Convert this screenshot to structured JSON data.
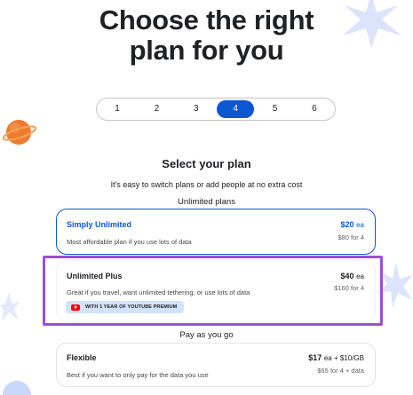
{
  "header": {
    "title": "Choose the right\nplan for you"
  },
  "stepper": {
    "options": [
      "1",
      "2",
      "3",
      "4",
      "5",
      "6"
    ],
    "selected": "4"
  },
  "main": {
    "section_title": "Select your plan",
    "section_subtitle": "It's easy to switch plans or add people at no extra cost",
    "group_unlimited": "Unlimited plans",
    "group_payg": "Pay as you go"
  },
  "plans": [
    {
      "name": "Simply Unlimited",
      "price": "$20",
      "price_unit": "ea",
      "description": "Most affordable plan if you use lots of data",
      "total": "$80 for 4"
    },
    {
      "name": "Unlimited Plus",
      "price": "$40",
      "price_unit": "ea",
      "description": "Great if you travel, want unlimited tethering, or use lots of data",
      "total": "$160 for 4",
      "perk": "WITH 1 YEAR OF YOUTUBE PREMIUM"
    },
    {
      "name": "Flexible",
      "price": "$17",
      "price_unit": "ea + $10/GB",
      "description": "Best if you want to only pay for the data you use",
      "total": "$65 for 4 + data"
    }
  ],
  "colors": {
    "accent": "#0b57d0",
    "highlight": "#9c4fd6",
    "planet": "#f07a2d",
    "decor_star": "#dbe4fb"
  }
}
